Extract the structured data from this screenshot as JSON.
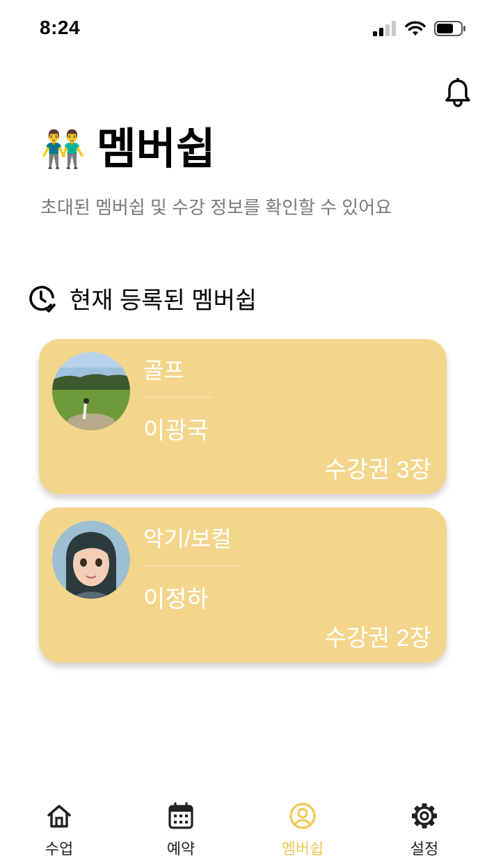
{
  "status_bar": {
    "time": "8:24"
  },
  "header": {
    "emoji": "👬",
    "title": "멤버쉽",
    "subtitle": "초대된 멤버쉽 및 수강 정보를 확인할 수 있어요"
  },
  "section": {
    "title": "현재 등록된 멤버쉽"
  },
  "memberships": [
    {
      "category": "골프",
      "instructor": "이광국",
      "tickets": "수강권 3장"
    },
    {
      "category": "악기/보컬",
      "instructor": "이정하",
      "tickets": "수강권 2장"
    }
  ],
  "tabs": [
    {
      "label": "수업",
      "icon": "home-icon"
    },
    {
      "label": "예약",
      "icon": "calendar-icon"
    },
    {
      "label": "멤버쉽",
      "icon": "user-circle-icon",
      "active": true
    },
    {
      "label": "설정",
      "icon": "gear-icon"
    }
  ],
  "colors": {
    "card": "#f3d68c",
    "accent": "#f0c95a",
    "subtitle": "#7a7a7a"
  }
}
